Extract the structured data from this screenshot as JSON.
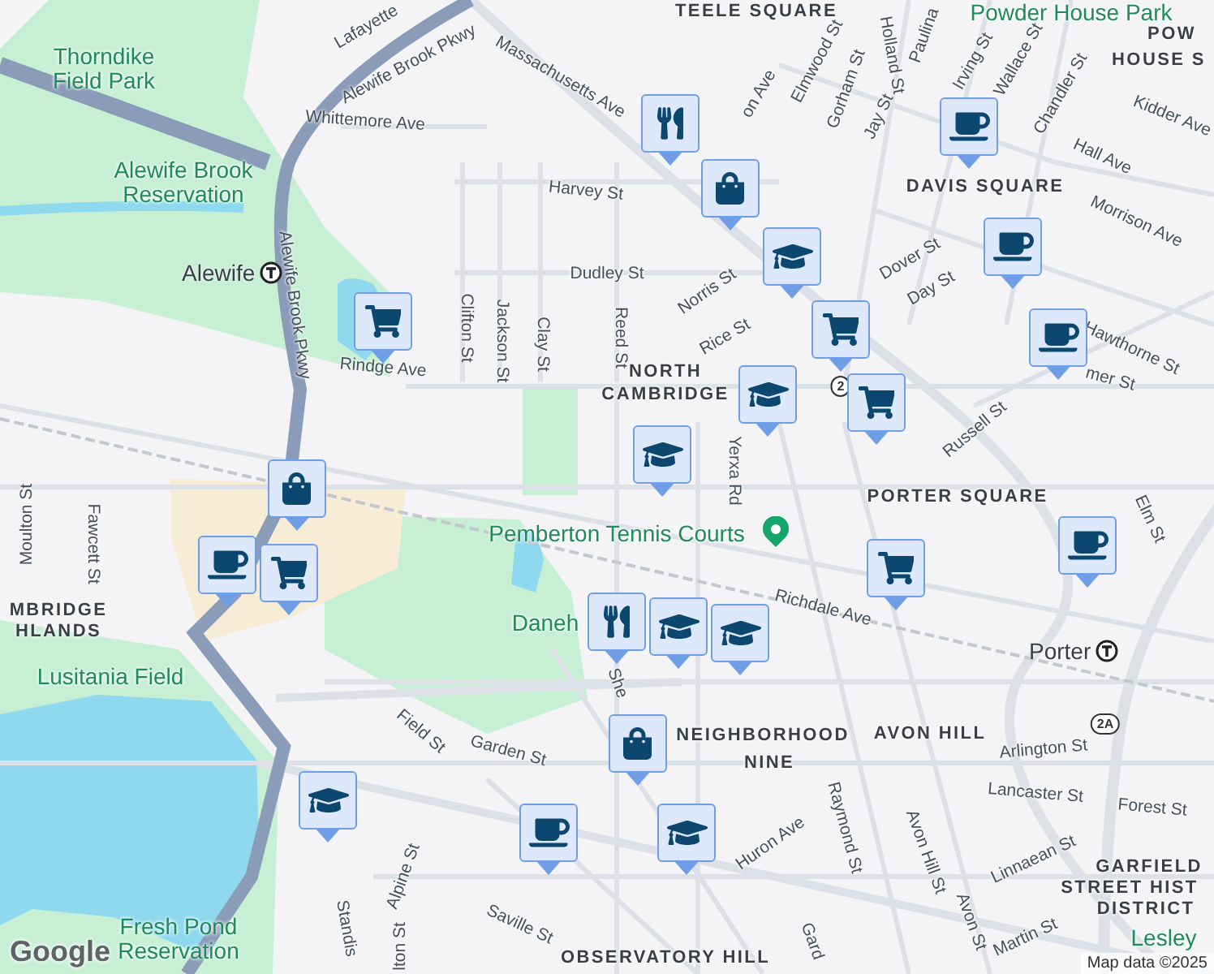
{
  "map": {
    "labels": [
      {
        "kind": "street",
        "text": "Lafayette"
      },
      {
        "kind": "street",
        "text": "Alewife Brook Pkwy"
      },
      {
        "kind": "street",
        "text": "Massachusetts Ave"
      },
      {
        "kind": "street",
        "text": "Whittemore Ave"
      },
      {
        "kind": "street",
        "text": "Harvey St"
      },
      {
        "kind": "street",
        "text": "Dudley St"
      },
      {
        "kind": "street",
        "text": "Alewife Brook Pkwy"
      },
      {
        "kind": "street",
        "text": "Clifton St"
      },
      {
        "kind": "street",
        "text": "Jackson St"
      },
      {
        "kind": "street",
        "text": "Clay St"
      },
      {
        "kind": "street",
        "text": "Reed St"
      },
      {
        "kind": "street",
        "text": "Rindge Ave"
      },
      {
        "kind": "street",
        "text": "Norris St"
      },
      {
        "kind": "street",
        "text": "Rice St"
      },
      {
        "kind": "street",
        "text": "Yerxa Rd"
      },
      {
        "kind": "street",
        "text": "Elmwood St"
      },
      {
        "kind": "street",
        "text": "Gorham St"
      },
      {
        "kind": "street",
        "text": "Jay St"
      },
      {
        "kind": "street",
        "text": "Holland St"
      },
      {
        "kind": "street",
        "text": "Paulina"
      },
      {
        "kind": "street",
        "text": "Irving St"
      },
      {
        "kind": "street",
        "text": "Wallace St"
      },
      {
        "kind": "street",
        "text": "Chandler St"
      },
      {
        "kind": "street",
        "text": "Kidder Ave"
      },
      {
        "kind": "street",
        "text": "Hall Ave"
      },
      {
        "kind": "street",
        "text": "Morrison Ave"
      },
      {
        "kind": "street",
        "text": "Dover St"
      },
      {
        "kind": "street",
        "text": "Day St"
      },
      {
        "kind": "street",
        "text": "Hawthorne St"
      },
      {
        "kind": "street",
        "text": "Russell St"
      },
      {
        "kind": "street",
        "text": "mer St"
      },
      {
        "kind": "street",
        "text": "Elm St"
      },
      {
        "kind": "street",
        "text": "Richdale Ave"
      },
      {
        "kind": "street",
        "text": "Moulton St"
      },
      {
        "kind": "street",
        "text": "Fawcett St"
      },
      {
        "kind": "street",
        "text": "Field St"
      },
      {
        "kind": "street",
        "text": "Garden St"
      },
      {
        "kind": "street",
        "text": "Alpine St"
      },
      {
        "kind": "street",
        "text": "Saville St"
      },
      {
        "kind": "street",
        "text": "Standis"
      },
      {
        "kind": "street",
        "text": "lton St"
      },
      {
        "kind": "street",
        "text": "Arlington St"
      },
      {
        "kind": "street",
        "text": "Lancaster St"
      },
      {
        "kind": "street",
        "text": "Forest St"
      },
      {
        "kind": "street",
        "text": "Raymond St"
      },
      {
        "kind": "street",
        "text": "Huron Ave"
      },
      {
        "kind": "street",
        "text": "Avon Hill St"
      },
      {
        "kind": "street",
        "text": "Linnaean St"
      },
      {
        "kind": "street",
        "text": "Martin St"
      },
      {
        "kind": "street",
        "text": "Avon St"
      },
      {
        "kind": "street",
        "text": "Gard"
      },
      {
        "kind": "street",
        "text": "She"
      },
      {
        "kind": "street",
        "text": "on Ave"
      },
      {
        "kind": "place",
        "text": "TEELE SQUARE"
      },
      {
        "kind": "place",
        "text": "POW"
      },
      {
        "kind": "place",
        "text": "HOUSE S"
      },
      {
        "kind": "place",
        "text": "DAVIS SQUARE"
      },
      {
        "kind": "place",
        "text": "NORTH"
      },
      {
        "kind": "place",
        "text": "CAMBRIDGE"
      },
      {
        "kind": "place",
        "text": "PORTER SQUARE"
      },
      {
        "kind": "place",
        "text": "NEIGHBORHOOD"
      },
      {
        "kind": "place",
        "text": "NINE"
      },
      {
        "kind": "place",
        "text": "AVON HILL"
      },
      {
        "kind": "place",
        "text": "OBSERVATORY HILL"
      },
      {
        "kind": "place",
        "text": "MBRIDGE"
      },
      {
        "kind": "place",
        "text": "HLANDS"
      },
      {
        "kind": "place",
        "text": "GARFIELD"
      },
      {
        "kind": "place",
        "text": "STREET HIST"
      },
      {
        "kind": "place",
        "text": "DISTRICT"
      },
      {
        "kind": "park",
        "text": "Thorndike\nField Park"
      },
      {
        "kind": "park",
        "text": "Alewife Brook\nReservation"
      },
      {
        "kind": "park",
        "text": "Lusitania Field"
      },
      {
        "kind": "park",
        "text": "Fresh Pond\nReservation"
      },
      {
        "kind": "park",
        "text": "Pemberton Tennis Courts"
      },
      {
        "kind": "park",
        "text": "Daneh"
      },
      {
        "kind": "park",
        "text": "Powder House Park"
      },
      {
        "kind": "park",
        "text": "Lesley"
      }
    ],
    "stations": [
      {
        "name": "Alewife"
      },
      {
        "name": "Porter"
      }
    ],
    "shields": [
      "2A",
      "2"
    ],
    "markers": [
      {
        "kind": "restaurant"
      },
      {
        "kind": "bag"
      },
      {
        "kind": "school"
      },
      {
        "kind": "grocery"
      },
      {
        "kind": "school"
      },
      {
        "kind": "grocery"
      },
      {
        "kind": "school"
      },
      {
        "kind": "coffee"
      },
      {
        "kind": "coffee"
      },
      {
        "kind": "coffee"
      },
      {
        "kind": "coffee"
      },
      {
        "kind": "grocery"
      },
      {
        "kind": "grocery"
      },
      {
        "kind": "bag"
      },
      {
        "kind": "coffee"
      },
      {
        "kind": "grocery"
      },
      {
        "kind": "restaurant"
      },
      {
        "kind": "school"
      },
      {
        "kind": "school"
      },
      {
        "kind": "bag"
      },
      {
        "kind": "school"
      },
      {
        "kind": "coffee"
      },
      {
        "kind": "school"
      }
    ]
  },
  "attribution": {
    "logo": "Google",
    "text": "Map data ©2025"
  }
}
